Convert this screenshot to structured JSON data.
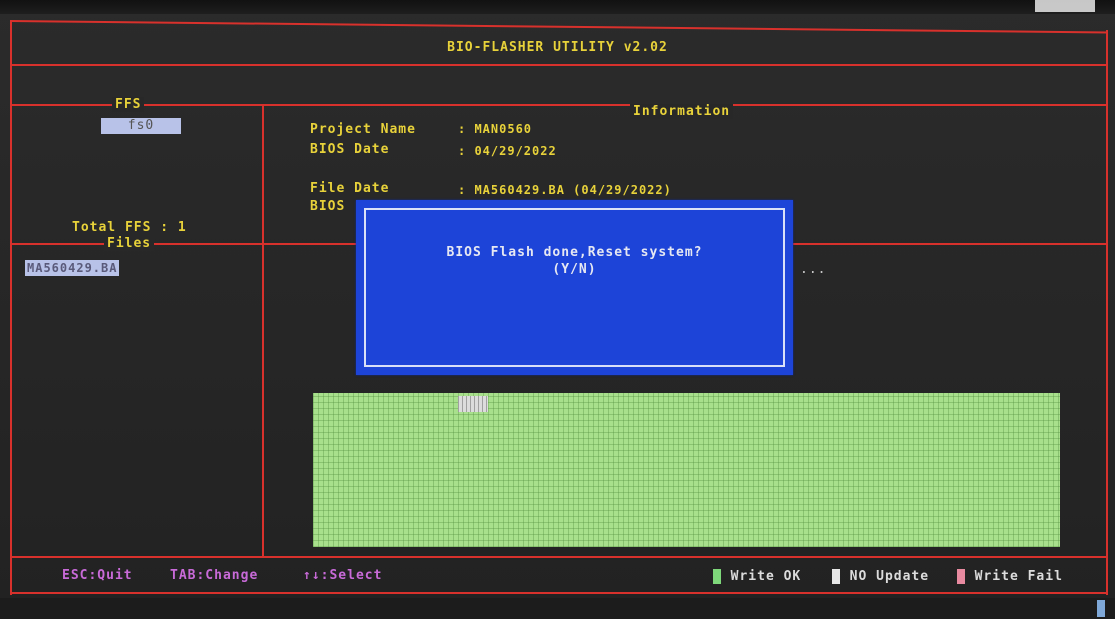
{
  "app": {
    "title": "BIO-FLASHER UTILITY v2.02"
  },
  "ffs_panel": {
    "label": "FFS",
    "item": "fs0",
    "total": "Total FFS : 1"
  },
  "files_panel": {
    "label": "Files",
    "item": "MA560429.BA"
  },
  "info_panel": {
    "label": "Information",
    "rows": [
      {
        "key": "Project Name",
        "value": ": MAN0560"
      },
      {
        "key": "BIOS Date",
        "value": ": 04/29/2022"
      },
      {
        "key": "File Date",
        "value": ": MA560429.BA (04/29/2022)"
      },
      {
        "key": "BIOS",
        "value": ""
      }
    ],
    "progress_dots": "..."
  },
  "dialog": {
    "message": "BIOS Flash done,Reset system?",
    "prompt": "(Y/N)"
  },
  "status_bar": {
    "esc": "ESC:Quit",
    "tab": "TAB:Change",
    "select": "↑↓:Select",
    "legend": [
      {
        "label": "Write OK",
        "color": "#7ed87a"
      },
      {
        "label": "NO Update",
        "color": "#e6e6e6"
      },
      {
        "label": "Write Fail",
        "color": "#e88aa0"
      }
    ]
  },
  "colors": {
    "frame_lines": "#d8312c",
    "text_yellow": "#e8d23a",
    "dialog_bg": "#1d44d8",
    "flash_grid": "#a8e08c",
    "status_text": "#c86ad8"
  }
}
